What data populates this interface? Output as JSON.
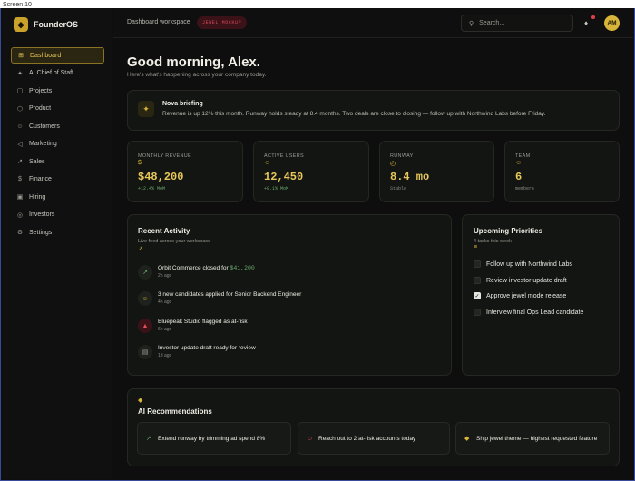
{
  "window": {
    "strip_label": "Screen 10"
  },
  "brand": {
    "name": "FounderOS",
    "logo_glyph": "◆"
  },
  "sidebar": {
    "items": [
      {
        "label": "Dashboard",
        "icon": "⊞",
        "icon_name": "grid-icon",
        "active": true
      },
      {
        "label": "AI Chief of Staff",
        "icon": "✦",
        "icon_name": "sparkle-icon"
      },
      {
        "label": "Projects",
        "icon": "▢",
        "icon_name": "folder-icon"
      },
      {
        "label": "Product",
        "icon": "⬡",
        "icon_name": "box-icon"
      },
      {
        "label": "Customers",
        "icon": "☺",
        "icon_name": "users-icon"
      },
      {
        "label": "Marketing",
        "icon": "◁",
        "icon_name": "megaphone-icon"
      },
      {
        "label": "Sales",
        "icon": "↗",
        "icon_name": "trend-icon"
      },
      {
        "label": "Finance",
        "icon": "$",
        "icon_name": "dollar-icon"
      },
      {
        "label": "Hiring",
        "icon": "▣",
        "icon_name": "briefcase-icon"
      },
      {
        "label": "Investors",
        "icon": "◎",
        "icon_name": "investors-icon"
      },
      {
        "label": "Settings",
        "icon": "⚙",
        "icon_name": "gear-icon"
      }
    ]
  },
  "header": {
    "workspace": "Dashboard workspace",
    "badge": "JEWEL MOCKUP",
    "search_placeholder": "Search...",
    "avatar": "AM",
    "accent": "#d8b43a"
  },
  "greeting": {
    "title": "Good morning, Alex.",
    "subtitle": "Here's what's happening across your company today."
  },
  "nova": {
    "title": "Nova briefing",
    "text": "Revenue is up 12% this month. Runway holds steady at 8.4 months. Two deals are close to closing — follow up with Northwind Labs before Friday."
  },
  "metrics": [
    {
      "label": "MONTHLY REVENUE",
      "icon": "$",
      "value": "$48,200",
      "delta": "+12.4% MoM",
      "delta_color": "#6aa86a"
    },
    {
      "label": "ACTIVE USERS",
      "icon": "☺",
      "value": "12,450",
      "delta": "+8.1% MoM",
      "delta_color": "#6aa86a"
    },
    {
      "label": "RUNWAY",
      "icon": "◴",
      "value": "8.4 mo",
      "delta": "Stable",
      "delta_color": "#8c8c84"
    },
    {
      "label": "TEAM",
      "icon": "☺",
      "value": "6",
      "delta": "members",
      "delta_color": "#8c8c84"
    }
  ],
  "activity": {
    "title": "Recent Activity",
    "subtitle": "Live feed across your workspace",
    "items": [
      {
        "text": "Orbit Commerce closed for ",
        "highlight": "$41,200",
        "time": "2h ago",
        "icon": "↗",
        "tone": "green"
      },
      {
        "text": "3 new candidates applied for Senior Backend Engineer",
        "highlight": "",
        "time": "4h ago",
        "icon": "☺",
        "tone": "gold"
      },
      {
        "text": "Bluepeak Studio flagged as at-risk",
        "highlight": "",
        "time": "6h ago",
        "icon": "▲",
        "tone": "red"
      },
      {
        "text": "Investor update draft ready for review",
        "highlight": "",
        "time": "1d ago",
        "icon": "▤",
        "tone": "gray"
      }
    ]
  },
  "priorities": {
    "title": "Upcoming Priorities",
    "subtitle": "4 tasks this week",
    "items": [
      {
        "label": "Follow up with Northwind Labs",
        "checked": false
      },
      {
        "label": "Review investor update draft",
        "checked": false
      },
      {
        "label": "Approve jewel mode release",
        "checked": true
      },
      {
        "label": "Interview final Ops Lead candidate",
        "checked": false
      }
    ]
  },
  "recommendations": {
    "title": "AI Recommendations",
    "items": [
      {
        "text": "Extend runway by trimming ad spend 8%",
        "icon": "↗",
        "icon_name": "trend-icon",
        "color": "#6aa86a"
      },
      {
        "text": "Reach out to 2 at-risk accounts today",
        "icon": "☺",
        "icon_name": "users-icon",
        "color": "#e0505a"
      },
      {
        "text": "Ship jewel theme — highest requested feature",
        "icon": "◆",
        "icon_name": "gem-icon",
        "color": "#d8b43a"
      }
    ]
  }
}
